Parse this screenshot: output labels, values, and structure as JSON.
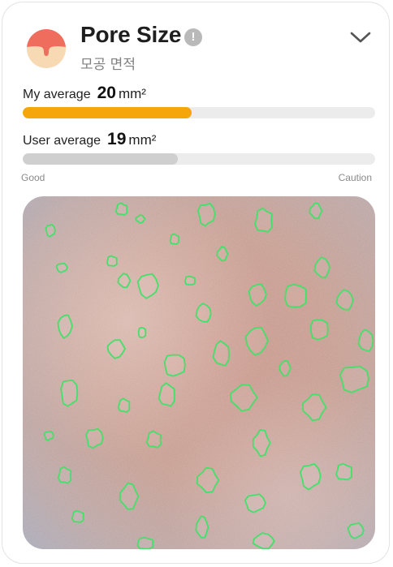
{
  "header": {
    "title": "Pore Size",
    "subtitle": "모공 면적",
    "info_icon": "!",
    "icon": "skin-pore-icon",
    "expand_icon": "chevron-down-icon"
  },
  "my_average": {
    "label": "My average",
    "value": "20",
    "unit": "mm²",
    "level": 0.48,
    "color": "#f5a60a"
  },
  "user_average": {
    "label": "User average",
    "value": "19",
    "unit": "mm²",
    "level": 0.44,
    "color": "#cfcfcf"
  },
  "scale": {
    "low": "Good",
    "high": "Caution"
  },
  "colors": {
    "accent": "#f5a60a",
    "pore_outline": "#43e06a",
    "icon_top": "#ef6d5c",
    "icon_base": "#f7d9b4"
  }
}
